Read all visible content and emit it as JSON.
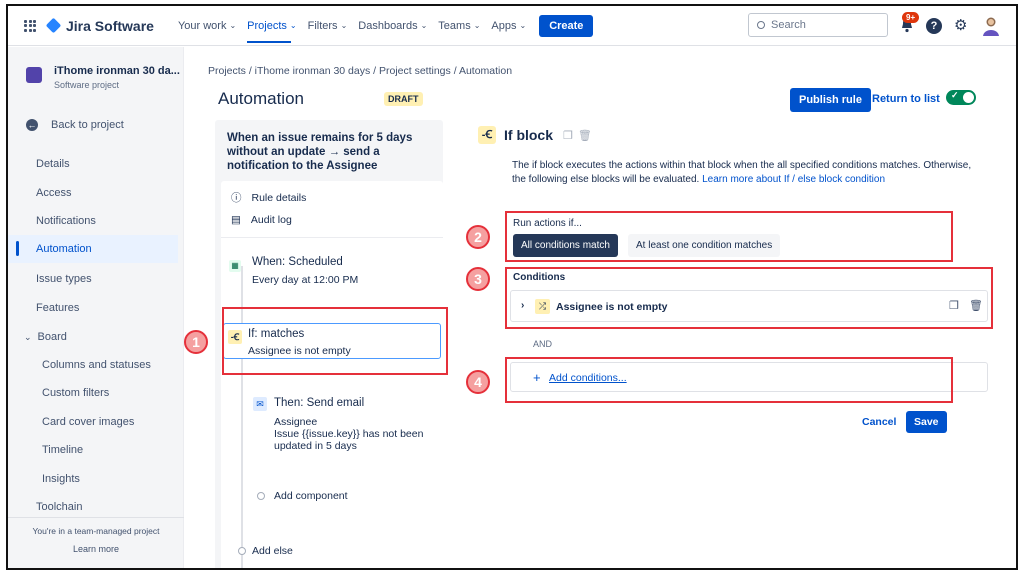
{
  "topbar": {
    "app_name": "Jira Software",
    "nav": [
      "Your work",
      "Projects",
      "Filters",
      "Dashboards",
      "Teams",
      "Apps"
    ],
    "create_label": "Create",
    "search_placeholder": "Search",
    "notification_badge": "9+",
    "help_label": "?"
  },
  "sidebar": {
    "project_name": "iThome ironman 30 da...",
    "project_type": "Software project",
    "back_label": "Back to project",
    "items": [
      "Details",
      "Access",
      "Notifications",
      "Automation",
      "Issue types",
      "Features"
    ],
    "board_label": "Board",
    "board_items": [
      "Columns and statuses",
      "Custom filters",
      "Card cover images",
      "Timeline",
      "Insights"
    ],
    "toolchain_label": "Toolchain",
    "footer_text": "You're in a team-managed project",
    "learn_more": "Learn more"
  },
  "header": {
    "breadcrumb": "Projects  /  iThome ironman 30 days  /  Project settings  /  Automation",
    "title": "Automation",
    "status_badge": "DRAFT",
    "publish_label": "Publish rule",
    "return_label": "Return to list"
  },
  "flow": {
    "heading": "When an issue remains for 5 days without an update → send a notification to the Assignee",
    "rule_details": "Rule details",
    "audit_log": "Audit log",
    "when_title": "When: Scheduled",
    "when_sub": "Every day at 12:00 PM",
    "if_title": "If: matches",
    "if_sub": "Assignee is not empty",
    "then_title": "Then: Send email",
    "then_line1": "Assignee",
    "then_line2": "Issue {{issue.key}} has not been updated in 5 days",
    "add_component": "Add component",
    "add_else": "Add else"
  },
  "editor": {
    "title": "If block",
    "description": "The if block executes the actions within that block when the all specified conditions matches. Otherwise, the following else blocks will be evaluated.",
    "learn_link": "Learn more about If / else block condition",
    "run_label": "Run actions if...",
    "option_all": "All conditions match",
    "option_one": "At least one condition matches",
    "conditions_label": "Conditions",
    "condition_text": "Assignee is not empty",
    "and_label": "AND",
    "add_conditions": "Add conditions...",
    "cancel_label": "Cancel",
    "save_label": "Save"
  },
  "annotations": [
    "1",
    "2",
    "3",
    "4"
  ],
  "colors": {
    "accent": "#0052CC",
    "highlight": "#E5303A",
    "toggle": "#00875A"
  }
}
